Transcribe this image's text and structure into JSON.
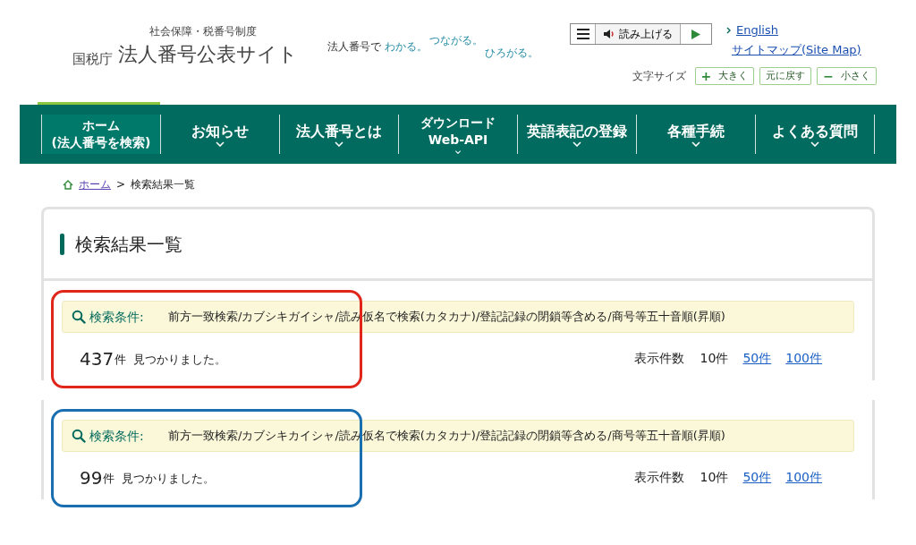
{
  "header": {
    "program": "社会保障・税番号制度",
    "agency": "国税庁",
    "site_name": "法人番号公表サイト",
    "tagline": {
      "lead": "法人番号で",
      "words": [
        "わかる。",
        "つながる。",
        "ひろがる。"
      ]
    },
    "read_aloud": {
      "label": "読み上げる"
    },
    "links": [
      "English",
      "サイトマップ(Site Map)"
    ],
    "font_size": {
      "label": "文字サイズ",
      "buttons": [
        {
          "sign": "+",
          "label": "大きく"
        },
        {
          "label": "元に戻す"
        },
        {
          "sign": "−",
          "label": "小さく"
        }
      ]
    }
  },
  "nav": [
    {
      "lines": [
        "ホーム",
        "(法人番号を検索)"
      ],
      "dropdown": false,
      "selected": true
    },
    {
      "lines": [
        "お知らせ"
      ],
      "dropdown": true,
      "selected": false
    },
    {
      "lines": [
        "法人番号とは"
      ],
      "dropdown": true,
      "selected": false
    },
    {
      "lines": [
        "ダウンロード",
        "Web-API"
      ],
      "dropdown": true,
      "selected": false
    },
    {
      "lines": [
        "英語表記の登録"
      ],
      "dropdown": true,
      "selected": false
    },
    {
      "lines": [
        "各種手続"
      ],
      "dropdown": true,
      "selected": false
    },
    {
      "lines": [
        "よくある質問"
      ],
      "dropdown": true,
      "selected": false
    }
  ],
  "breadcrumb": {
    "home": "ホーム",
    "separator": ">",
    "current": "検索結果一覧"
  },
  "page_title": "検索結果一覧",
  "results": [
    {
      "condition_label": "検索条件:",
      "condition": "前方一致検索/カブシキガイシャ/読み仮名で検索(カタカナ)/登記記録の閉鎖等含める/商号等五十音順(昇順)",
      "count": "437",
      "count_unit": "件",
      "found_text": "見つかりました。",
      "per_page_label": "表示件数",
      "per_page": [
        {
          "label": "10件",
          "selected": true
        },
        {
          "label": "50件",
          "selected": false
        },
        {
          "label": "100件",
          "selected": false
        }
      ],
      "color": "#e0261b"
    },
    {
      "condition_label": "検索条件:",
      "condition": "前方一致検索/カブシキカイシャ/読み仮名で検索(カタカナ)/登記記録の閉鎖等含める/商号等五十音順(昇順)",
      "count": "99",
      "count_unit": "件",
      "found_text": "見つかりました。",
      "per_page_label": "表示件数",
      "per_page": [
        {
          "label": "10件",
          "selected": true
        },
        {
          "label": "50件",
          "selected": false
        },
        {
          "label": "100件",
          "selected": false
        }
      ],
      "color": "#1a6fb0"
    }
  ]
}
